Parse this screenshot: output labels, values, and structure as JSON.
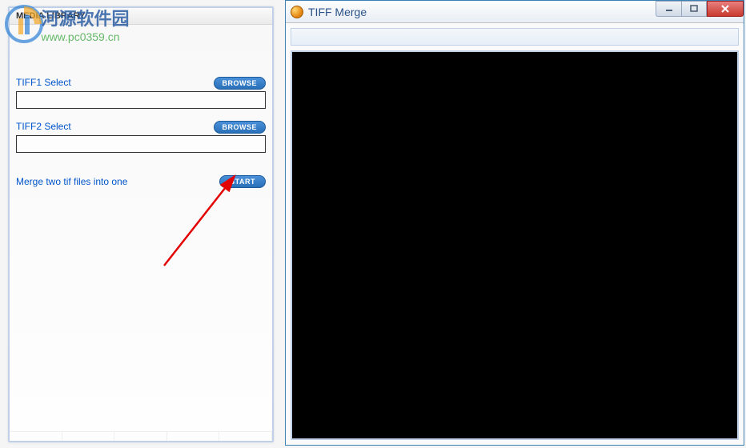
{
  "watermark": {
    "title": "河源软件园",
    "url": "www.pc0359.cn"
  },
  "leftPanel": {
    "header": "MEDIA LIBRARY",
    "tiff1": {
      "label": "TIFF1 Select",
      "browseLabel": "BROWSE",
      "value": ""
    },
    "tiff2": {
      "label": "TIFF2 Select",
      "browseLabel": "BROWSE",
      "value": ""
    },
    "merge": {
      "label": "Merge two tif files into one",
      "startLabel": "START"
    }
  },
  "rightWindow": {
    "title": "TIFF Merge"
  }
}
